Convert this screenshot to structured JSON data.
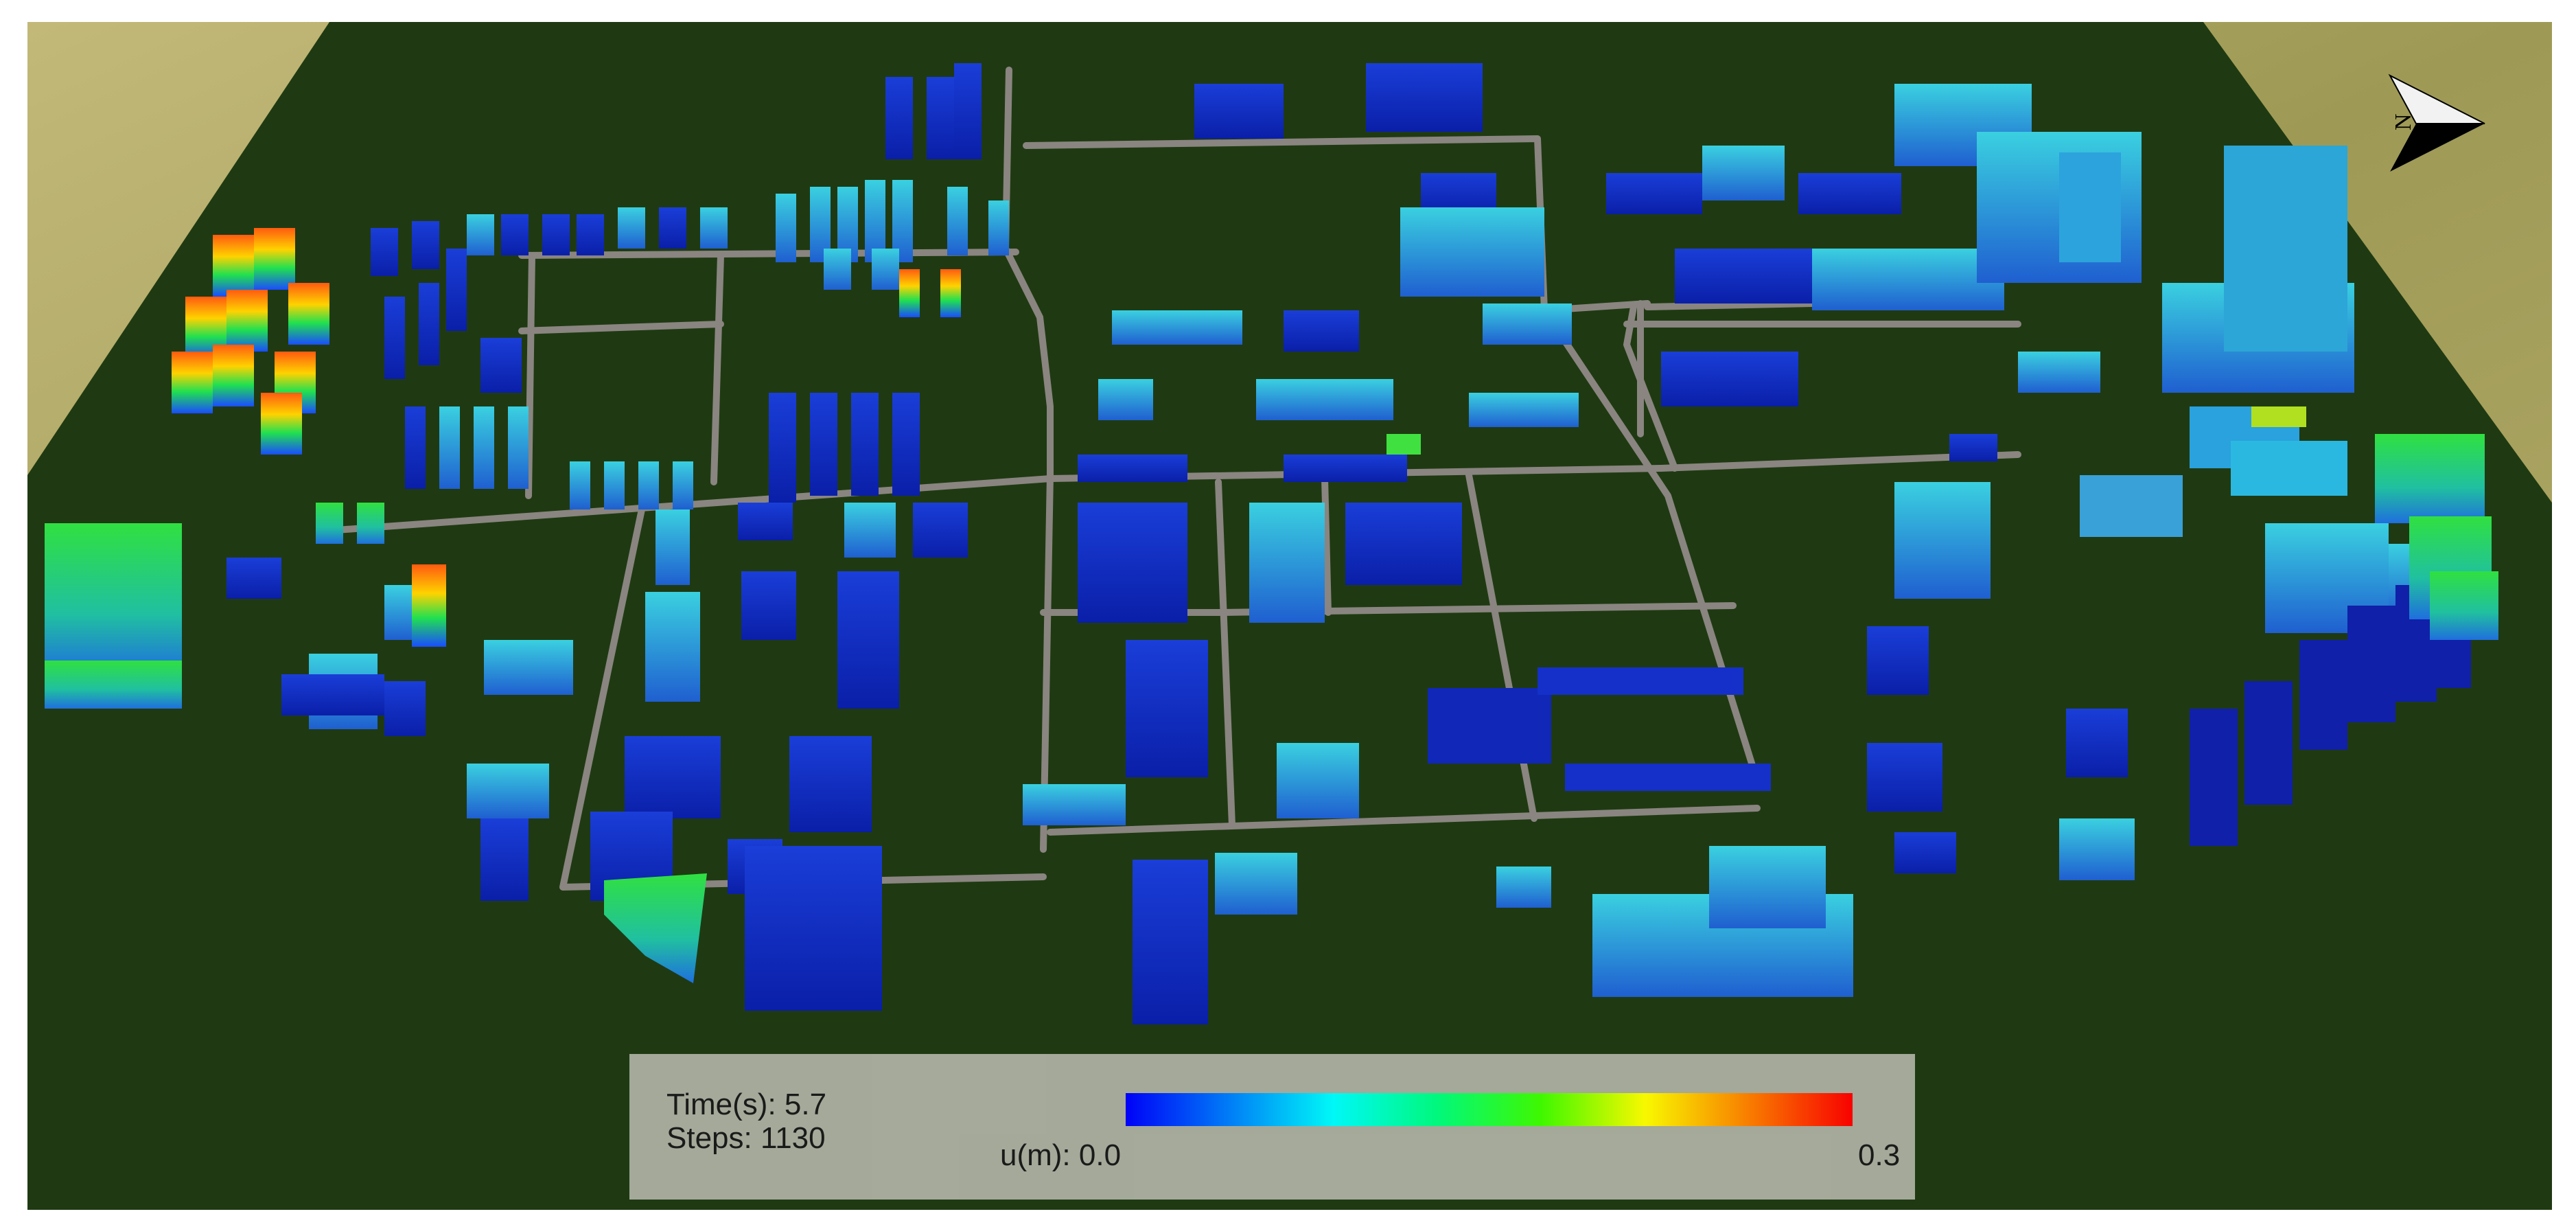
{
  "legend": {
    "time_label": "Time(s):",
    "time_value": "5.7",
    "steps_label": "Steps:",
    "steps_value": "1130",
    "variable_label": "u(m):",
    "range_min": "0.0",
    "range_max": "0.3",
    "colormap": [
      "#0000ff",
      "#0080ff",
      "#00ffff",
      "#00ff80",
      "#40ff00",
      "#ffff00",
      "#ff8000",
      "#ff0000"
    ]
  },
  "compass": {
    "direction_letter": "N"
  },
  "colors": {
    "ground": "#1f3a12",
    "grass": "#b6ac6c",
    "road": "#8a8580",
    "building_low": "#0a2fc0",
    "building_mid": "#1f98cc",
    "building_high": "#e85a18"
  }
}
